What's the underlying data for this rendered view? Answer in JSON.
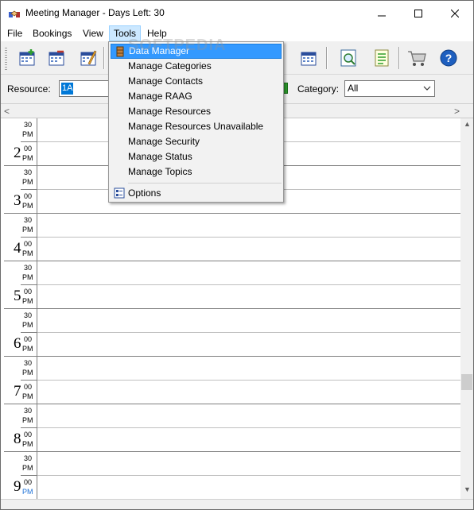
{
  "window": {
    "title": "Meeting Manager - Days Left:  30",
    "minimize_glyph": "—",
    "maximize_glyph": "☐",
    "close_glyph": "✕"
  },
  "menubar": {
    "items": [
      {
        "label": "File"
      },
      {
        "label": "Bookings"
      },
      {
        "label": "View"
      },
      {
        "label": "Tools"
      },
      {
        "label": "Help"
      }
    ],
    "active": "Tools"
  },
  "watermark": "SOFTPEDIA",
  "tools_menu": {
    "items": [
      {
        "label": "Data Manager",
        "icon": "database-icon",
        "highlighted": true
      },
      {
        "label": "Manage Categories"
      },
      {
        "label": "Manage Contacts"
      },
      {
        "label": "Manage RAAG"
      },
      {
        "label": "Manage Resources"
      },
      {
        "label": "Manage Resources Unavailable"
      },
      {
        "label": "Manage Security"
      },
      {
        "label": "Manage Status"
      },
      {
        "label": "Manage Topics"
      }
    ],
    "options": {
      "label": "Options",
      "icon": "options-icon"
    }
  },
  "filters": {
    "resource_label": "Resource:",
    "resource_value": "1A",
    "category_label": "Category:",
    "category_value": "All"
  },
  "calendar": {
    "top_partial": {
      "minutes": "30",
      "ampm": "PM"
    },
    "hours": [
      {
        "hour": "2",
        "minutes": "00",
        "ampm": "PM",
        "half_minutes": "30",
        "half_ampm": "PM"
      },
      {
        "hour": "3",
        "minutes": "00",
        "ampm": "PM",
        "half_minutes": "30",
        "half_ampm": "PM"
      },
      {
        "hour": "4",
        "minutes": "00",
        "ampm": "PM",
        "half_minutes": "30",
        "half_ampm": "PM"
      },
      {
        "hour": "5",
        "minutes": "00",
        "ampm": "PM",
        "half_minutes": "30",
        "half_ampm": "PM"
      },
      {
        "hour": "6",
        "minutes": "00",
        "ampm": "PM",
        "half_minutes": "30",
        "half_ampm": "PM"
      },
      {
        "hour": "7",
        "minutes": "00",
        "ampm": "PM",
        "half_minutes": "30",
        "half_ampm": "PM"
      },
      {
        "hour": "8",
        "minutes": "00",
        "ampm": "PM",
        "half_minutes": "30",
        "half_ampm": "PM"
      },
      {
        "hour": "9",
        "minutes": "00",
        "ampm": "PM"
      }
    ]
  },
  "scroll": {
    "left": "<",
    "right": ">",
    "up": "▲",
    "down": "▼"
  },
  "colors": {
    "accent": "#3399ff",
    "menu_active_bg": "#cce8ff",
    "selection": "#0078d7"
  }
}
